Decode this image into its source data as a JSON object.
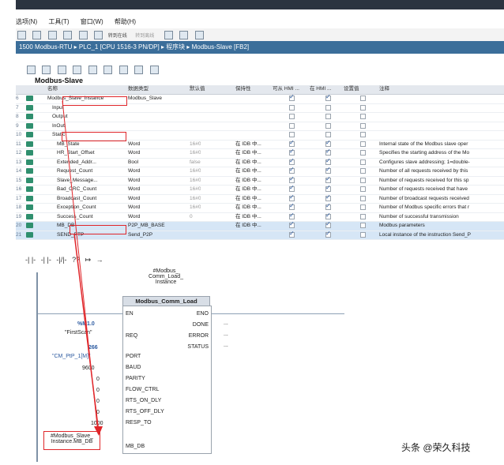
{
  "menu": [
    "选项(N)",
    "工具(T)",
    "窗口(W)",
    "帮助(H)"
  ],
  "toolbar": {
    "go_online": "转到在线",
    "go_offline": "转到离线"
  },
  "breadcrumb": "1500 Modbus-RTU ▸ PLC_1 [CPU 1516-3 PN/DP] ▸ 程序块 ▸ Modbus-Slave [FB2]",
  "panel_title": "Modbus-Slave",
  "columns": [
    "名称",
    "数据类型",
    "默认值",
    "保持性",
    "可从 HMI ...",
    "在 HMI ...",
    "设置值",
    "注释"
  ],
  "rows": [
    {
      "num": "6",
      "name": "Modbus_Slave_Instance",
      "type": "Modbus_Slave",
      "default": "",
      "retain": "",
      "hmi1": true,
      "hmi2": true,
      "comment": ""
    },
    {
      "num": "7",
      "name": "Input",
      "type": "",
      "default": "",
      "retain": "",
      "hmi1": false,
      "hmi2": false,
      "comment": ""
    },
    {
      "num": "8",
      "name": "Output",
      "type": "",
      "default": "",
      "retain": "",
      "hmi1": false,
      "hmi2": false,
      "comment": ""
    },
    {
      "num": "9",
      "name": "InOut",
      "type": "",
      "default": "",
      "retain": "",
      "hmi1": false,
      "hmi2": false,
      "comment": ""
    },
    {
      "num": "10",
      "name": "Static",
      "type": "",
      "default": "",
      "retain": "",
      "hmi1": false,
      "hmi2": false,
      "comment": ""
    },
    {
      "num": "11",
      "name": "MB_State",
      "type": "Word",
      "default": "16#0",
      "retain": "在 IDB 中...",
      "hmi1": true,
      "hmi2": true,
      "comment": "Internal state of the Modbus slave oper"
    },
    {
      "num": "12",
      "name": "HR_Start_Offset",
      "type": "Word",
      "default": "16#0",
      "retain": "在 IDB 中...",
      "hmi1": true,
      "hmi2": true,
      "comment": "Specifies the starting address of the Mo"
    },
    {
      "num": "13",
      "name": "Extended_Addr...",
      "type": "Bool",
      "default": "false",
      "retain": "在 IDB 中...",
      "hmi1": true,
      "hmi2": true,
      "comment": "Configures slave addressing; 1=double-"
    },
    {
      "num": "14",
      "name": "Request_Count",
      "type": "Word",
      "default": "16#0",
      "retain": "在 IDB 中...",
      "hmi1": true,
      "hmi2": true,
      "comment": "Number of all requests received by this"
    },
    {
      "num": "15",
      "name": "Slave_Message...",
      "type": "Word",
      "default": "16#0",
      "retain": "在 IDB 中...",
      "hmi1": true,
      "hmi2": true,
      "comment": "Number of requests received for this sp"
    },
    {
      "num": "16",
      "name": "Bad_CRC_Count",
      "type": "Word",
      "default": "16#0",
      "retain": "在 IDB 中...",
      "hmi1": true,
      "hmi2": true,
      "comment": "Number of requests received that have"
    },
    {
      "num": "17",
      "name": "Broadcast_Count",
      "type": "Word",
      "default": "16#0",
      "retain": "在 IDB 中...",
      "hmi1": true,
      "hmi2": true,
      "comment": "Number of broadcast requests received"
    },
    {
      "num": "18",
      "name": "Exception_Count",
      "type": "Word",
      "default": "16#0",
      "retain": "在 IDB 中...",
      "hmi1": true,
      "hmi2": true,
      "comment": "Number of Modbus specific errors that r"
    },
    {
      "num": "19",
      "name": "Success_Count",
      "type": "Word",
      "default": "0",
      "retain": "在 IDB 中...",
      "hmi1": true,
      "hmi2": true,
      "comment": "Number of successful transmission"
    },
    {
      "num": "20",
      "name": "MB_DB",
      "type": "P2P_MB_BASE",
      "default": "",
      "retain": "在 IDB 中...",
      "hmi1": true,
      "hmi2": true,
      "comment": "Modbus parameters"
    },
    {
      "num": "21",
      "name": "SEND_PTP",
      "type": "Send_P2P",
      "default": "",
      "retain": "",
      "hmi1": true,
      "hmi2": true,
      "comment": "Local instance of the instruction Send_P"
    }
  ],
  "ladder_icons": [
    "-| |-",
    "-| |-",
    "-|/|-",
    "??",
    "↦",
    "→"
  ],
  "block": {
    "instance_label": "#Modbus_\nComm_Load_\nInstance",
    "title": "Modbus_Comm_Load",
    "pins_left": [
      "EN",
      "REQ",
      "PORT",
      "BAUD",
      "PARITY",
      "FLOW_CTRL",
      "RTS_ON_DLY",
      "RTS_OFF_DLY",
      "RESP_TO",
      "MB_DB"
    ],
    "pins_right": [
      "ENO",
      "DONE",
      "ERROR",
      "STATUS"
    ],
    "params": {
      "req_addr": "%M1.0",
      "req_name": "\"FirstScan\"",
      "port_num": "266",
      "port_name": "\"CM_PtP_1[M]\"",
      "baud": "9600",
      "parity": "0",
      "flow": "0",
      "rts_on": "0",
      "rts_off": "0",
      "resp_to": "1000",
      "mb_db": "#Modbus_Slave_\nInstance.MB_DB",
      "done": "...",
      "error": "...",
      "status": "..."
    }
  },
  "watermark": "头条 @荣久科技",
  "colors": {
    "accent": "#3b6e9a",
    "highlight": "#e0262a",
    "param_blue": "#2c5aa0"
  }
}
